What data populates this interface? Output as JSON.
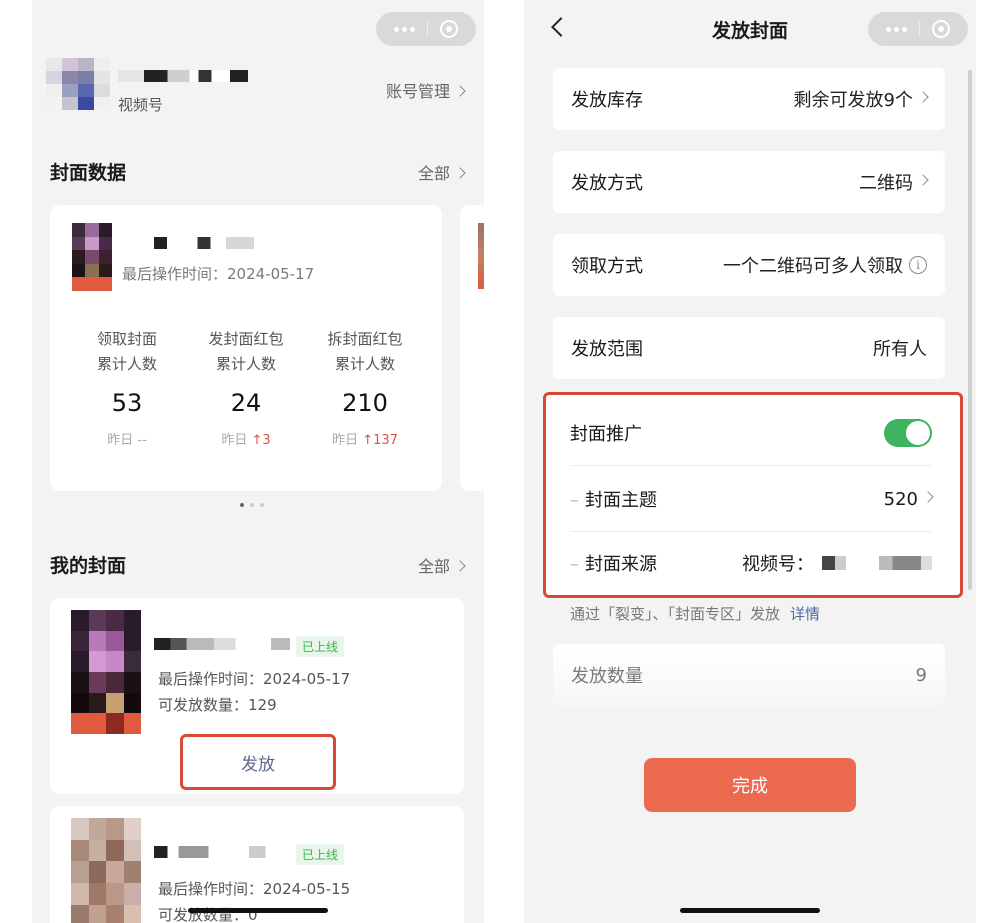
{
  "left": {
    "account": {
      "label": "视频号",
      "manage": "账号管理"
    },
    "cover_data": {
      "title": "封面数据",
      "all": "全部",
      "last_op": "最后操作时间：2024-05-17",
      "stats": [
        {
          "line1": "领取封面",
          "line2": "累计人数",
          "value": "53",
          "yesterday_label": "昨日",
          "yesterday_value": "--",
          "up": false
        },
        {
          "line1": "发封面红包",
          "line2": "累计人数",
          "value": "24",
          "yesterday_label": "昨日",
          "yesterday_value": "↑3",
          "up": true
        },
        {
          "line1": "拆封面红包",
          "line2": "累计人数",
          "value": "210",
          "yesterday_label": "昨日",
          "yesterday_value": "↑137",
          "up": true
        }
      ]
    },
    "my_covers": {
      "title": "我的封面",
      "all": "全部",
      "items": [
        {
          "status": "已上线",
          "last_op": "最后操作时间：2024-05-17",
          "count": "可发放数量：129",
          "button": "发放"
        },
        {
          "status": "已上线",
          "last_op": "最后操作时间：2024-05-15",
          "count": "可发放数量：0"
        }
      ]
    }
  },
  "right": {
    "title": "发放封面",
    "rows": [
      {
        "label": "发放库存",
        "value": "剩余可发放9个",
        "chevron": true
      },
      {
        "label": "发放方式",
        "value": "二维码",
        "chevron": true
      },
      {
        "label": "领取方式",
        "value": "一个二维码可多人领取",
        "info": true
      },
      {
        "label": "发放范围",
        "value": "所有人"
      }
    ],
    "promotion": {
      "label": "封面推广",
      "enabled": true,
      "theme_label": "封面主题",
      "theme_value": "520",
      "source_label": "封面来源",
      "source_value": "视频号："
    },
    "note": "通过「裂变」、「封面专区」发放",
    "note_link": "详情",
    "quantity": {
      "label": "发放数量",
      "value": "9"
    },
    "done": "完成"
  },
  "colors": {
    "accent_red": "#d64a35",
    "button": "#ec6a50",
    "toggle_on": "#3db560",
    "link": "#4b6aa0",
    "up": "#e0504a"
  }
}
